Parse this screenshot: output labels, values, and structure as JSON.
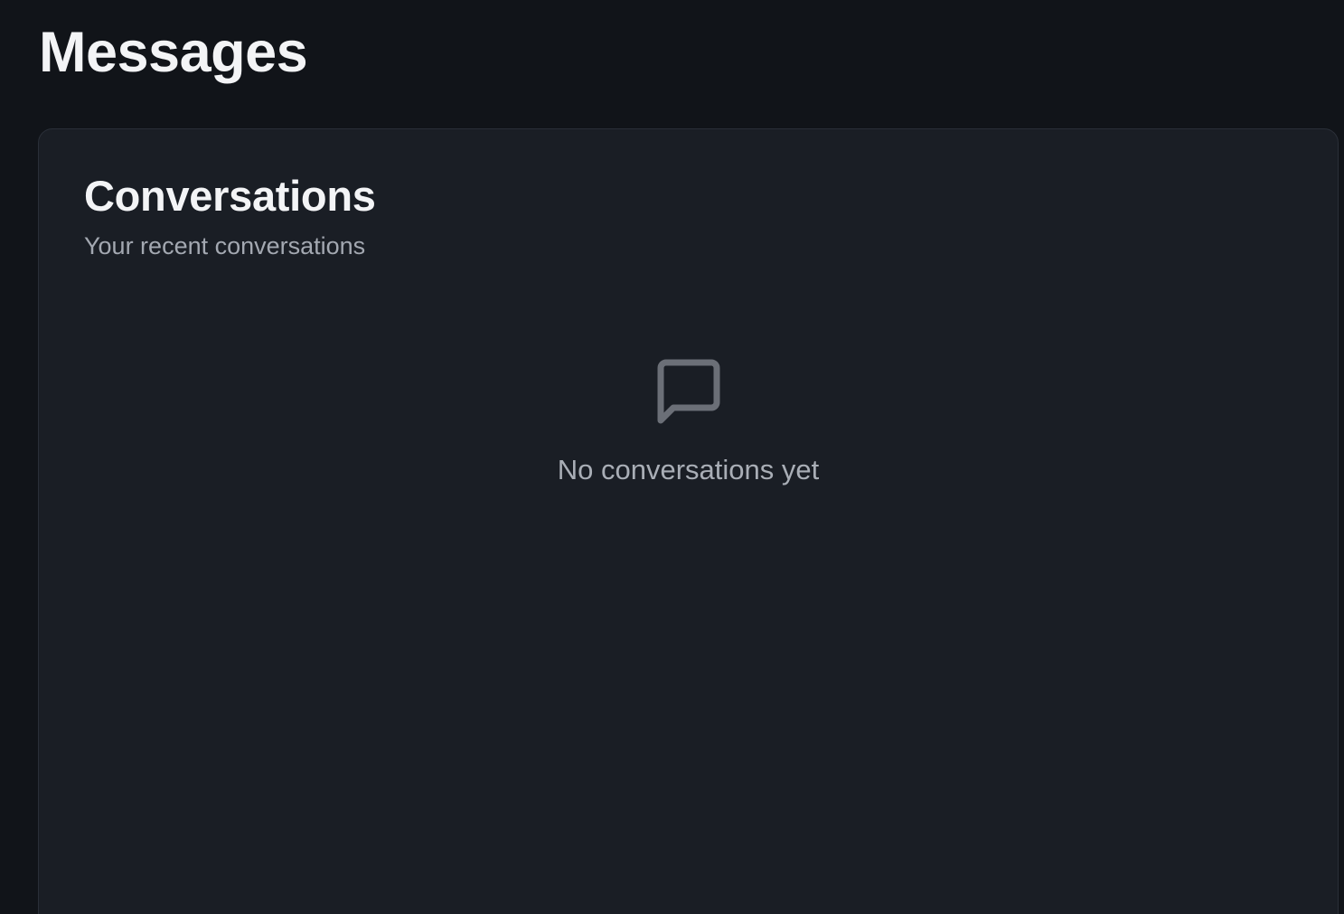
{
  "page": {
    "title": "Messages"
  },
  "conversations": {
    "title": "Conversations",
    "subtitle": "Your recent conversations",
    "empty_state": {
      "icon": "message-square-icon",
      "text": "No conversations yet"
    }
  },
  "colors": {
    "background": "#111419",
    "card": "#1a1e25",
    "text_primary": "#f3f4f6",
    "text_secondary": "#a3a8b1",
    "icon": "#6b6f77"
  }
}
